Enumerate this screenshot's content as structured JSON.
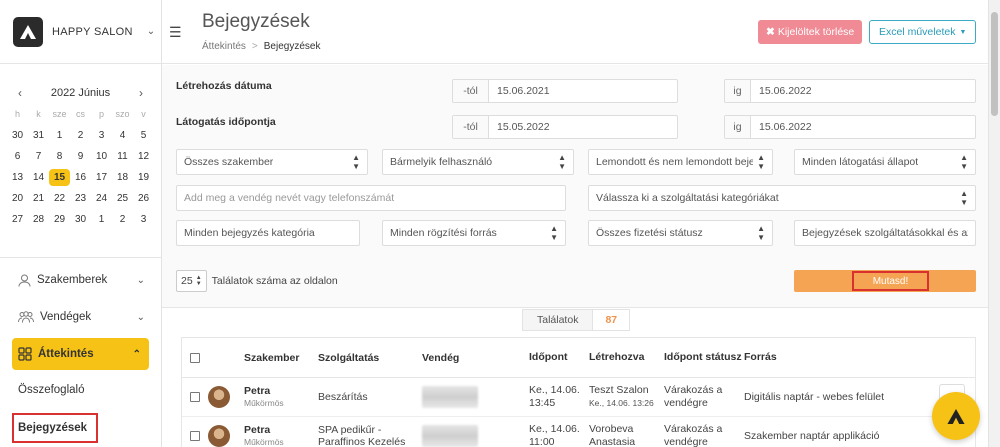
{
  "brand": {
    "name": "HAPPY SALON"
  },
  "calendar": {
    "month_label": "2022 Június",
    "weekdays": [
      "h",
      "k",
      "sze",
      "cs",
      "p",
      "szo",
      "v"
    ],
    "weeks": [
      [
        "30",
        "31",
        "1",
        "2",
        "3",
        "4",
        "5"
      ],
      [
        "6",
        "7",
        "8",
        "9",
        "10",
        "11",
        "12"
      ],
      [
        "13",
        "14",
        "15",
        "16",
        "17",
        "18",
        "19"
      ],
      [
        "20",
        "21",
        "22",
        "23",
        "24",
        "25",
        "26"
      ],
      [
        "27",
        "28",
        "29",
        "30",
        "1",
        "2",
        "3"
      ]
    ],
    "today": "15"
  },
  "nav": {
    "specialists": "Szakemberek",
    "guests": "Vendégek",
    "overview": "Áttekintés",
    "summary": "Összefoglaló",
    "entries": "Bejegyzések"
  },
  "header": {
    "title": "Bejegyzések",
    "crumb_home": "Áttekintés",
    "crumb_sep": ">",
    "crumb_current": "Bejegyzések",
    "delete_label": "Kijelöltek törlése",
    "excel_label": "Excel műveletek"
  },
  "filters": {
    "created_label": "Létrehozás dátuma",
    "visit_label": "Látogatás időpontja",
    "from_prefix": "-tól",
    "to_prefix": "ig",
    "created_from": "15.06.2021",
    "created_to": "15.06.2022",
    "visit_from": "15.05.2022",
    "visit_to": "15.06.2022",
    "specialist": "Összes szakember",
    "user": "Bármelyik felhasználó",
    "cancelled": "Lemondott és nem lemondott beje",
    "visit_state": "Minden látogatási állapot",
    "guest_placeholder": "Add meg a vendég nevét vagy telefonszámát",
    "service_category": "Válassza ki a szolgáltatási kategóriákat",
    "entry_category": "Minden bejegyzés kategória",
    "source": "Minden rögzítési forrás",
    "payment": "Összes fizetési státusz",
    "entries_with": "Bejegyzések szolgáltatásokkal és az",
    "per_page": "25",
    "per_page_label": "Találatok száma az oldalon",
    "show_label": "Mutasd!"
  },
  "results": {
    "label": "Találatok",
    "count": "87",
    "columns": [
      "Szakember",
      "Szolgáltatás",
      "Vendég",
      "Időpont",
      "Létrehozva",
      "Időpont státusz",
      "Forrás"
    ],
    "rows": [
      {
        "name": "Petra",
        "role": "Műkörmös",
        "service": "Beszárítás",
        "date": "Ke., 14.06.",
        "time": "13:45",
        "created_by": "Teszt Szalon",
        "created_at": "Ke., 14.06. 13:26",
        "status1": "Várakozás a",
        "status2": "vendégre",
        "source": "Digitális naptár - webes felület"
      },
      {
        "name": "Petra",
        "role": "Műkörmös",
        "service1": "SPA pedikűr -",
        "service2": "Paraffinos Kezelés",
        "date": "Ke., 14.06.",
        "time": "11:00",
        "created_by1": "Vorobeva",
        "created_by2": "Anastasia",
        "status1": "Várakozás a",
        "status2": "vendégre",
        "source": "Szakember naptár applikáció"
      }
    ]
  }
}
